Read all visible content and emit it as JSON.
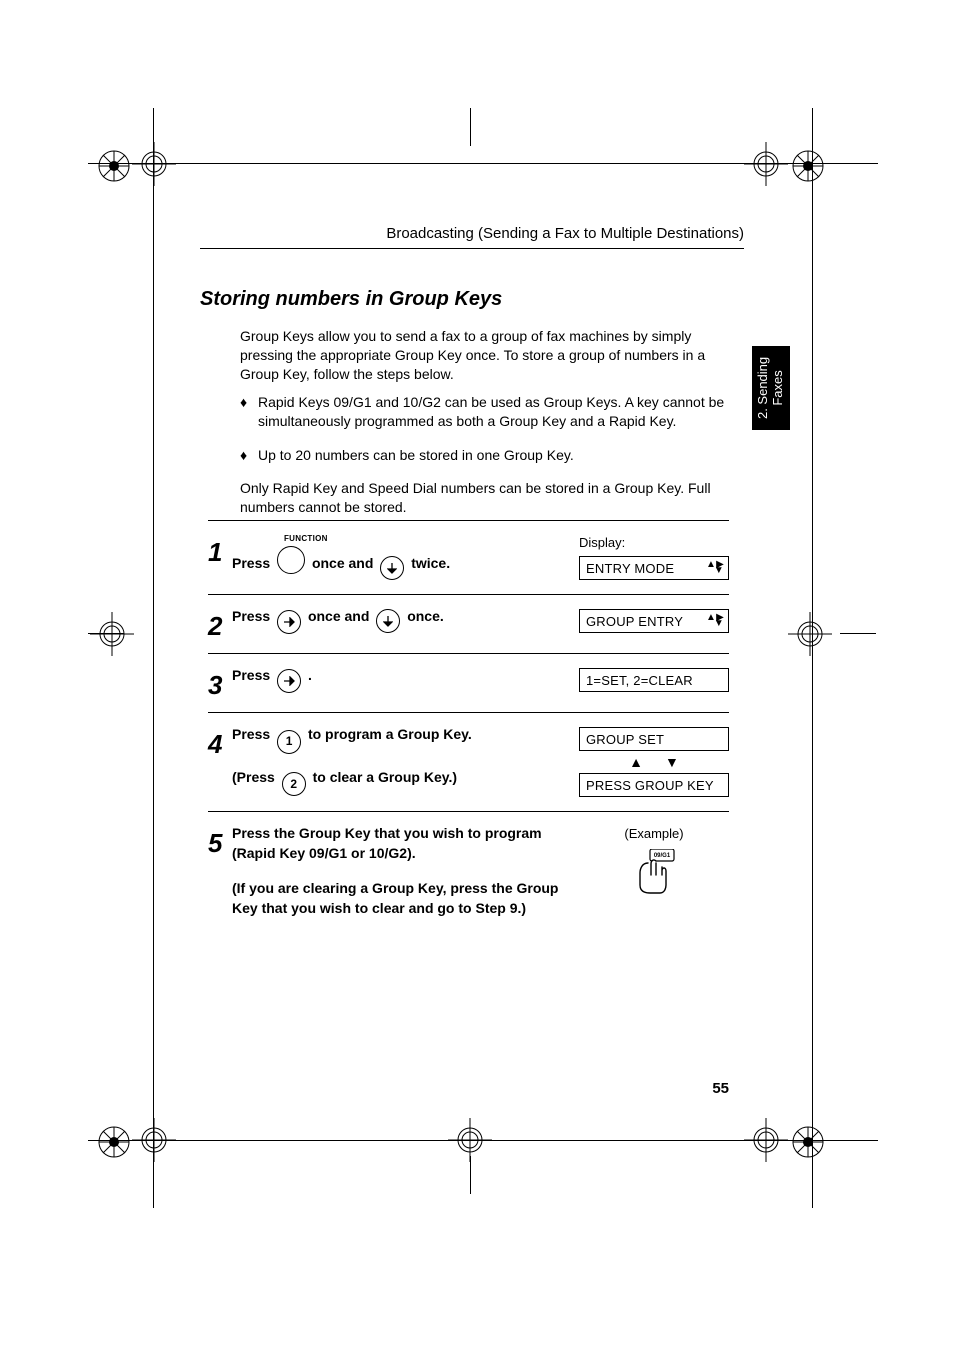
{
  "header": {
    "running": "Broadcasting (Sending a Fax to Multiple Destinations)"
  },
  "sidebar_tab": "2. Sending\nFaxes",
  "section_title": "Storing numbers in Group Keys",
  "paragraphs": {
    "intro": "Group Keys allow you to send a fax to a group of fax machines by simply pressing the appropriate Group Key once. To store a group of numbers in a Group Key, follow the steps below.",
    "b1": "Rapid Keys 09/G1 and 10/G2 can be used as Group Keys. A key cannot be simultaneously programmed as both a Group Key and a Rapid Key.",
    "b2": "Up to 20 numbers can be stored in one Group Key.",
    "note": "Only Rapid Key and Speed Dial numbers can be stored in a Group Key. Full numbers cannot be stored."
  },
  "bullet": "♦",
  "steps": {
    "s1": {
      "num": "1",
      "function_label": "FUNCTION",
      "t_press": "Press",
      "t_mid": "once and",
      "t_end": "twice.",
      "display_label": "Display:",
      "display": "ENTRY MODE"
    },
    "s2": {
      "num": "2",
      "t_press": "Press",
      "t_mid": "once and",
      "t_end": "once.",
      "display": "GROUP ENTRY"
    },
    "s3": {
      "num": "3",
      "t_press": "Press",
      "t_end": ".",
      "display": "1=SET, 2=CLEAR"
    },
    "s4": {
      "num": "4",
      "line1a": "Press",
      "key1": "1",
      "line1b": "to program a Group Key.",
      "line2a": "(Press",
      "key2": "2",
      "line2b": "to clear a Group Key.)",
      "display_top": "GROUP SET",
      "display_bottom": "PRESS GROUP KEY"
    },
    "s5": {
      "num": "5",
      "line1": "Press the Group Key that you wish to program (Rapid Key 09/G1 or 10/G2).",
      "line2": "(If you are clearing a Group Key, press the Group Key that you wish to clear and go to Step 9.)",
      "example_lbl": "(Example)",
      "key_label": "09/G1"
    }
  },
  "page_number": "55"
}
